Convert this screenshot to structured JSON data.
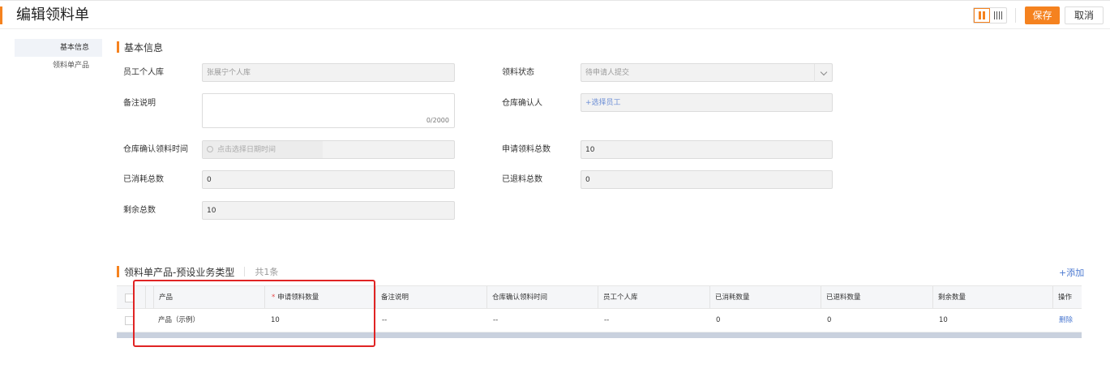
{
  "header": {
    "title": "编辑领料单",
    "save_label": "保存",
    "cancel_label": "取消"
  },
  "sidebar": {
    "items": [
      {
        "label": "基本信息",
        "active": true
      },
      {
        "label": "领料单产品",
        "active": false
      }
    ]
  },
  "basic_info": {
    "section_title": "基本信息",
    "fields": {
      "employee_store": {
        "label": "员工个人库",
        "value": "张展宁个人库"
      },
      "status": {
        "label": "领料状态",
        "value": "待申请人提交"
      },
      "remark": {
        "label": "备注说明",
        "value": "",
        "counter": "0/2000"
      },
      "warehouse_confirmer": {
        "label": "仓库确认人",
        "value": "+选择员工"
      },
      "confirm_time": {
        "label": "仓库确认领料时间",
        "placeholder": "点击选择日期时间"
      },
      "apply_total": {
        "label": "申请领料总数",
        "value": "10"
      },
      "consumed_total": {
        "label": "已消耗总数",
        "value": "0"
      },
      "returned_total": {
        "label": "已退料总数",
        "value": "0"
      },
      "remaining_total": {
        "label": "剩余总数",
        "value": "10"
      }
    }
  },
  "products": {
    "section_title": "领料单产品-预设业务类型",
    "count": "共1条",
    "add_label": "+添加",
    "columns": [
      "产品",
      "申请领料数量",
      "备注说明",
      "仓库确认领料时间",
      "员工个人库",
      "已消耗数量",
      "已退料数量",
      "剩余数量",
      "操作"
    ],
    "rows": [
      {
        "product": "产品（示例）",
        "apply_qty": "10",
        "remark": "--",
        "confirm_time": "--",
        "employee_store": "--",
        "consumed": "0",
        "returned": "0",
        "remaining": "10",
        "action": "删除"
      }
    ]
  },
  "colors": {
    "accent": "#f5821f",
    "link": "#4a78d0",
    "highlight": "#e02424"
  }
}
